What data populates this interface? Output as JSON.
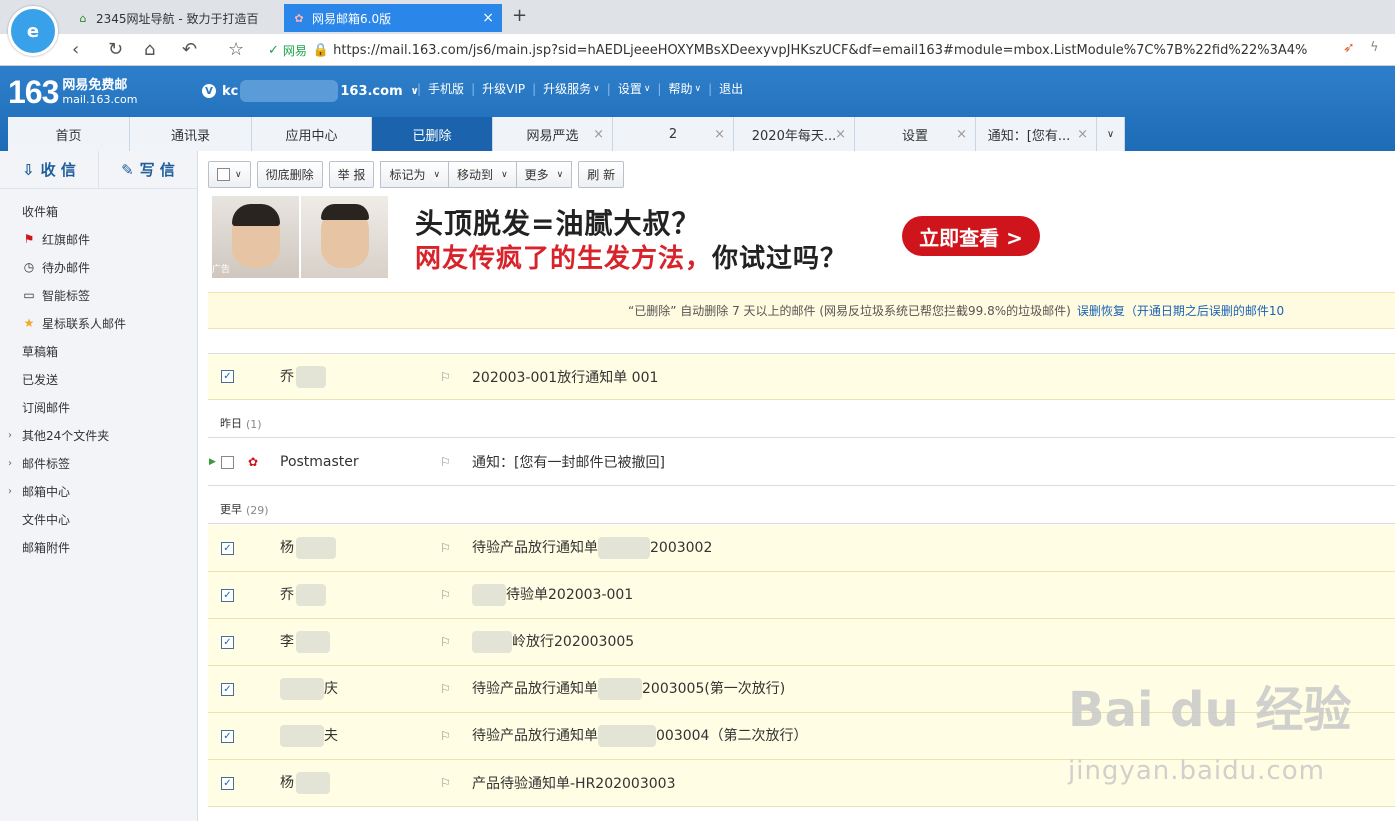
{
  "browser": {
    "tab1_title": "2345网址导航 - 致力于打造百",
    "tab2_title": "网易邮箱6.0版",
    "new_tab": "+",
    "close": "×",
    "url": "https://mail.163.com/js6/main.jsp?sid=hAEDLjeeeHOXYMBsXDeexyvpJHKszUCF&df=email163#module=mbox.ListModule%7C%7B%22fid%22%3A4%",
    "site_label": "网易"
  },
  "header": {
    "brand_num": "163",
    "brand_line1": "网易免费邮",
    "brand_line2": "mail.163.com",
    "user_prefix": "kc",
    "user_suffix": "163.com",
    "links": [
      "手机版",
      "升级VIP",
      "升级服务",
      "设置",
      "帮助",
      "退出"
    ]
  },
  "mail_tabs": [
    {
      "label": "首页"
    },
    {
      "label": "通讯录"
    },
    {
      "label": "应用中心"
    },
    {
      "label": "已删除"
    },
    {
      "label": "网易严选"
    },
    {
      "label": "2"
    },
    {
      "label": "2020年每天..."
    },
    {
      "label": "设置"
    },
    {
      "label": "通知：[您有..."
    }
  ],
  "sidebar": {
    "receive": "收 信",
    "compose": "写 信",
    "items": [
      {
        "label": "收件箱"
      },
      {
        "label": "红旗邮件"
      },
      {
        "label": "待办邮件"
      },
      {
        "label": "智能标签"
      },
      {
        "label": "星标联系人邮件"
      },
      {
        "label": "草稿箱"
      },
      {
        "label": "已发送"
      },
      {
        "label": "订阅邮件"
      },
      {
        "label": "其他24个文件夹"
      },
      {
        "label": "邮件标签"
      },
      {
        "label": "邮箱中心"
      },
      {
        "label": "文件中心"
      },
      {
        "label": "邮箱附件"
      }
    ]
  },
  "toolbar": {
    "delete_forever": "彻底删除",
    "report": "举 报",
    "mark_as": "标记为",
    "move_to": "移动到",
    "more": "更多",
    "refresh": "刷 新"
  },
  "ad": {
    "line1": "头顶脱发=油腻大叔？",
    "line2_red": "网友传疯了的生发方法，",
    "line2_black": "你试过吗？",
    "cta": "立即查看 >",
    "tag": "广告"
  },
  "notice": {
    "text": "“已删除” 自动删除 7 天以上的邮件 (网易反垃圾系统已帮您拦截99.8%的垃圾邮件)",
    "link": "误删恢复（开通日期之后误删的邮件10"
  },
  "groups": {
    "yesterday": "昨日",
    "yesterday_count": "(1)",
    "earlier": "更早",
    "earlier_count": "(29)"
  },
  "mails": [
    {
      "from": "乔",
      "subject": "202003-001放行通知单 001"
    },
    {
      "from": "Postmaster",
      "subject": "通知：[您有一封邮件已被撤回]"
    },
    {
      "from": "杨",
      "subject_a": "待验产品放行通知单",
      "subject_b": "2003002"
    },
    {
      "from": "乔",
      "subject_b": "待验单202003-001"
    },
    {
      "from": "李",
      "subject_b": "岭放行202003005"
    },
    {
      "from_b": "庆",
      "subject_a": "待验产品放行通知单",
      "subject_b": "2003005(第一次放行)"
    },
    {
      "from_b": "夫",
      "subject_a": "待验产品放行通知单",
      "subject_b": "003004（第二次放行）"
    },
    {
      "from": "杨",
      "subject": "产品待验通知单-HR202003003"
    }
  ],
  "watermark": {
    "main": "Bai du 经验",
    "sub": "jingyan.baidu.com"
  }
}
